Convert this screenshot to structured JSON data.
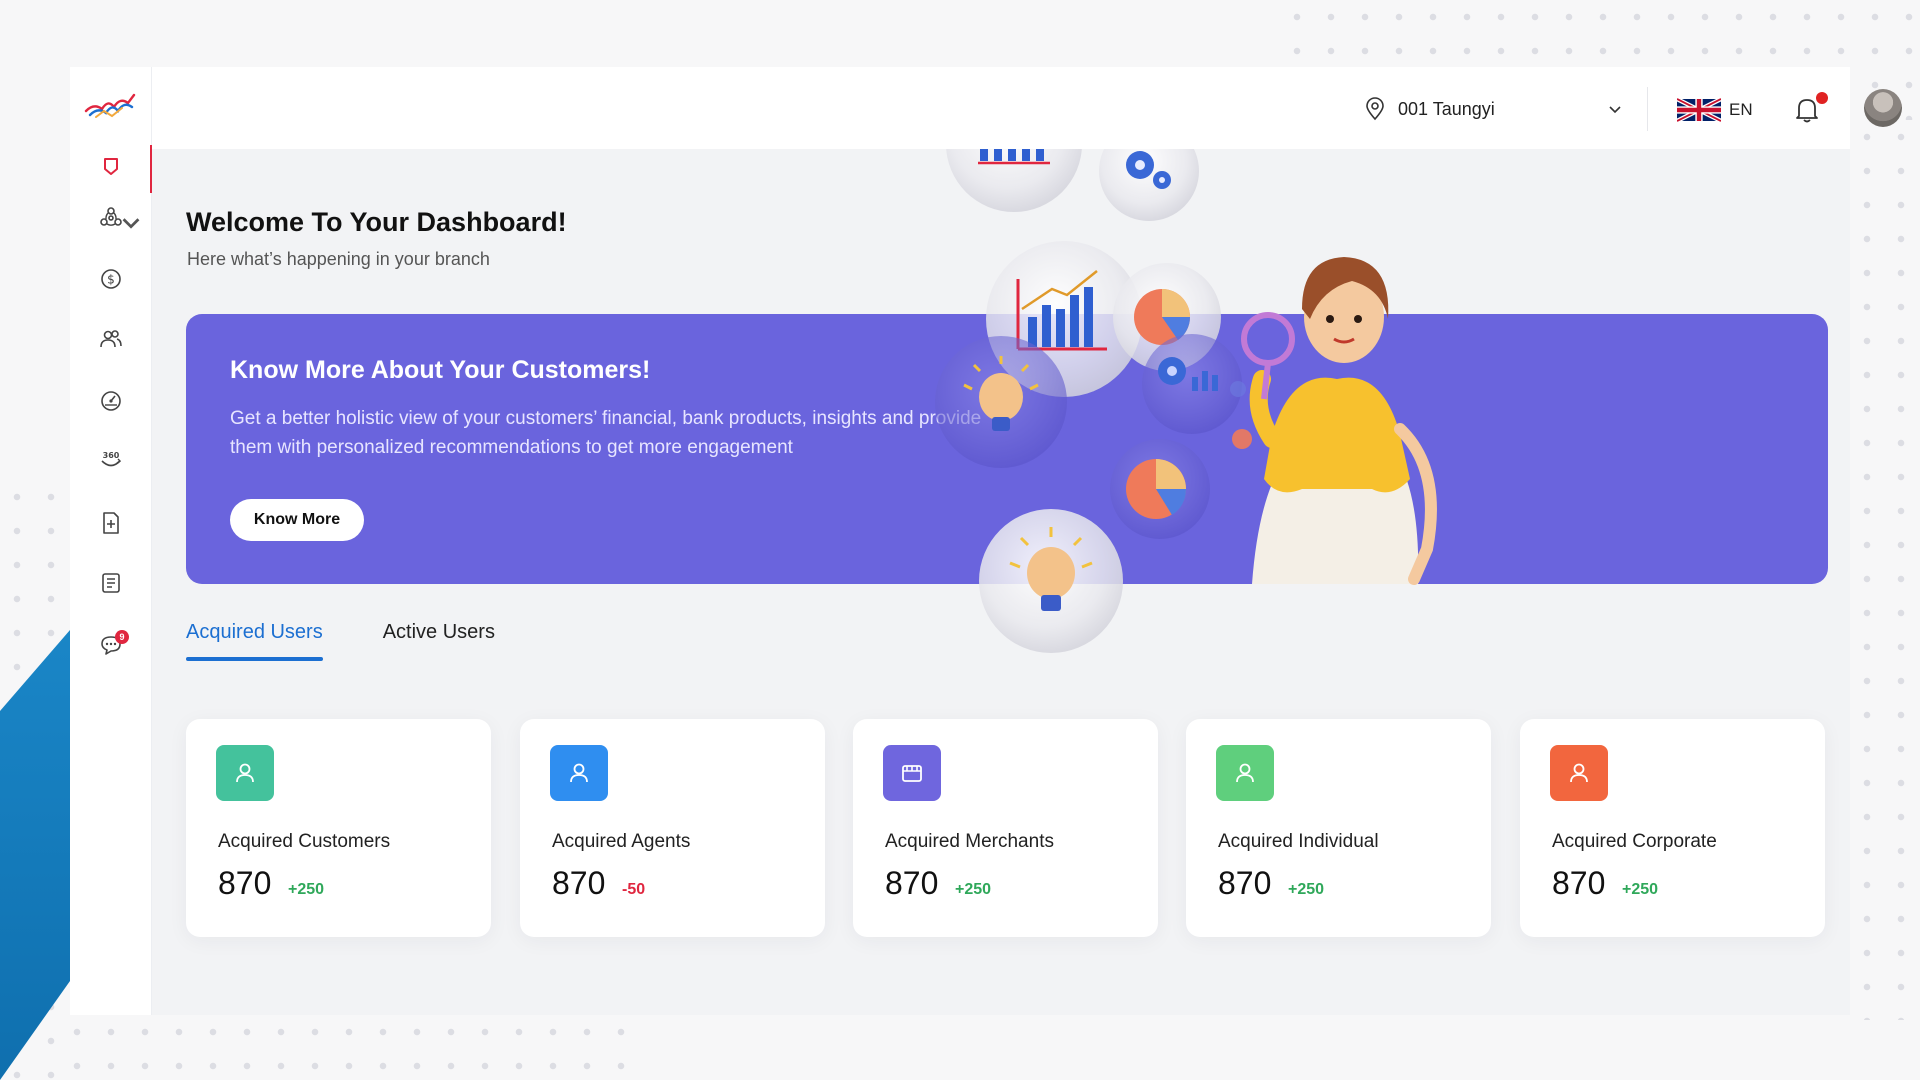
{
  "header": {
    "branch_label": "001 Taungyi",
    "language_code": "EN",
    "has_notification": true
  },
  "sidebar": {
    "items": [
      {
        "icon": "shield-icon",
        "active": true
      },
      {
        "icon": "share-network-icon",
        "has_caret": true
      },
      {
        "icon": "dollar-icon"
      },
      {
        "icon": "users-icon"
      },
      {
        "icon": "dashboard-gauge-icon"
      },
      {
        "icon": "360-view-icon"
      },
      {
        "icon": "add-document-icon"
      },
      {
        "icon": "list-document-icon"
      },
      {
        "icon": "chat-icon",
        "badge": "9"
      }
    ]
  },
  "welcome": {
    "title": "Welcome To Your Dashboard!",
    "subtitle": "Here what’s happening in your branch"
  },
  "banner": {
    "title": "Know More About Your Customers!",
    "text": "Get a better holistic view of your customers’ financial, bank products, insights and provide them with personalized recommendations to get more engagement",
    "button_label": "Know More",
    "background": "#6a64dd"
  },
  "tabs": [
    {
      "label": "Acquired Users",
      "active": true
    },
    {
      "label": "Active Users",
      "active": false
    }
  ],
  "cards": [
    {
      "label": "Acquired Customers",
      "value": "870",
      "delta": "+250",
      "icon": "user-icon",
      "icon_color": "#44c29c",
      "delta_color": "#2fa85a"
    },
    {
      "label": "Acquired Agents",
      "value": "870",
      "delta": "-50",
      "icon": "user-icon",
      "icon_color": "#2f8ef0",
      "delta_color": "#e0263f"
    },
    {
      "label": "Acquired Merchants",
      "value": "870",
      "delta": "+250",
      "icon": "store-icon",
      "icon_color": "#6f66de",
      "delta_color": "#2fa85a"
    },
    {
      "label": "Acquired Individual",
      "value": "870",
      "delta": "+250",
      "icon": "user-icon",
      "icon_color": "#5fcf7d",
      "delta_color": "#2fa85a"
    },
    {
      "label": "Acquired Corporate",
      "value": "870",
      "delta": "+250",
      "icon": "user-icon",
      "icon_color": "#f2663e",
      "delta_color": "#2fa85a"
    }
  ],
  "colors": {
    "accent": "#1c6fd1",
    "active_indicator": "#e0263f"
  }
}
